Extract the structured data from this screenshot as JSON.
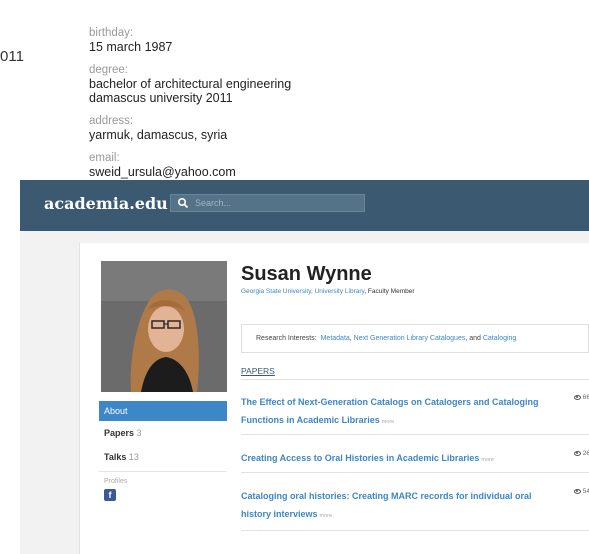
{
  "profile_fragment": {
    "year_fragment": "011",
    "fields": [
      {
        "label": "birthday:",
        "value": [
          "15 march 1987"
        ]
      },
      {
        "label": "degree:",
        "value": [
          "bachelor of architectural engineering",
          "damascus university 2011"
        ]
      },
      {
        "label": "address:",
        "value": [
          "yarmuk, damascus, syria"
        ]
      },
      {
        "label": "email:",
        "value": [
          "sweid_ursula@yahoo.com"
        ]
      }
    ]
  },
  "header": {
    "brand": "academia.edu",
    "search_placeholder": "Search...",
    "bar_color": "#3b5a72"
  },
  "profile": {
    "name": "Susan Wynne",
    "affiliation_links": "Georgia State University, University Library",
    "affiliation_role": ", Faculty Member",
    "interests_label": "Research Interests:",
    "interests": [
      {
        "text": "Metadata"
      },
      {
        "text": "Next Generation Library Catalogues"
      },
      {
        "text": "Cataloging"
      }
    ]
  },
  "sidebar": {
    "items": [
      {
        "label": "About",
        "count": ""
      },
      {
        "label": "Papers",
        "count": "3"
      },
      {
        "label": "Talks",
        "count": "13"
      }
    ],
    "profiles_label": "Profiles",
    "facebook_icon": "f"
  },
  "papers": {
    "heading": "PAPERS",
    "more_label": "more",
    "items": [
      {
        "title": "The Effect of Next-Generation Catalogs on Catalogers and Cataloging Functions in Academic Libraries",
        "views": "66"
      },
      {
        "title": "Creating Access to Oral Histories in Academic Libraries",
        "views": "26"
      },
      {
        "title": "Cataloging oral histories: Creating MARC records for individual oral history interviews",
        "views": "54"
      }
    ]
  },
  "colors": {
    "accent": "#3d86c7",
    "active_tab": "#3d86c7"
  }
}
